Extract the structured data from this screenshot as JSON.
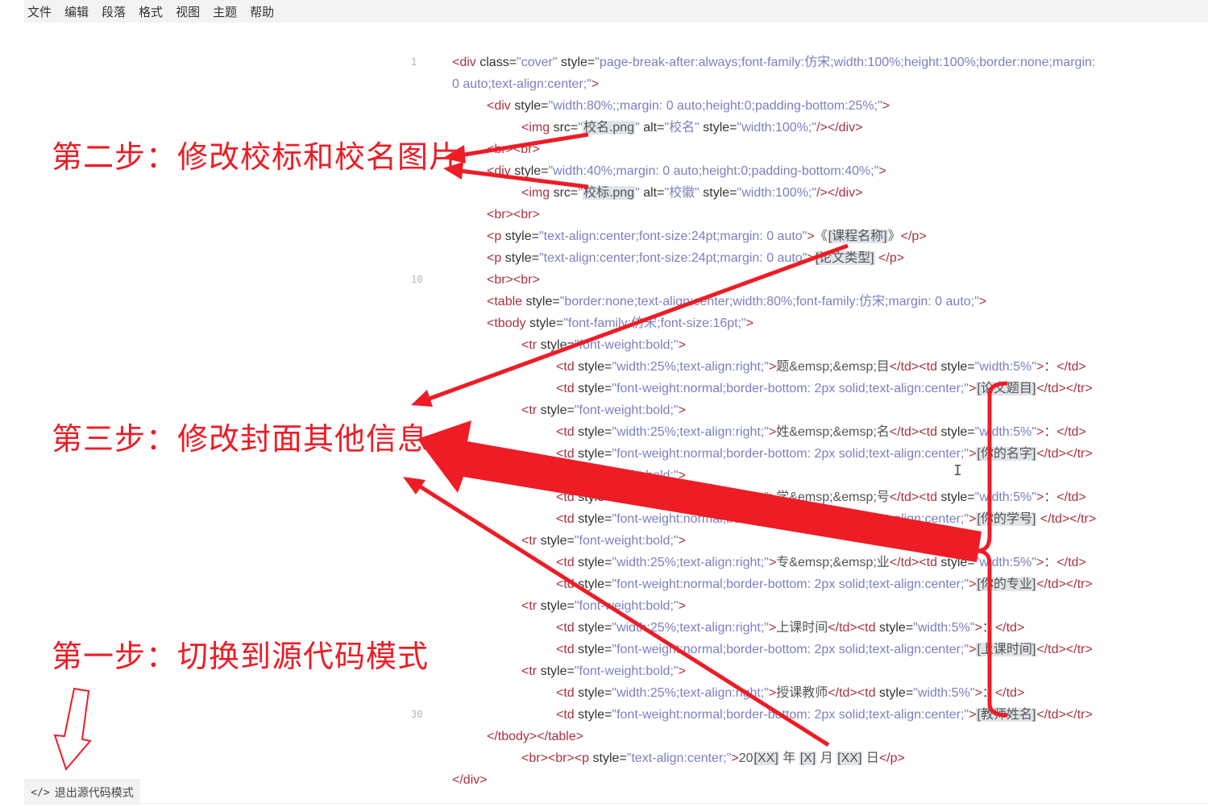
{
  "menubar": {
    "items": [
      "文件",
      "编辑",
      "段落",
      "格式",
      "视图",
      "主题",
      "帮助"
    ]
  },
  "annotations": {
    "step2": "第二步：修改校标和校名图片",
    "step3": "第三步：修改封面其他信息",
    "step1": "第一步：切换到源代码模式"
  },
  "statusbar": {
    "exit_icon": "</>",
    "exit_label": "退出源代码模式"
  },
  "code": {
    "line_numbers": [
      "1",
      "10",
      "30"
    ],
    "lines": [
      {
        "indent": 0,
        "ln": "1",
        "tokens": [
          [
            "tag",
            "<div "
          ],
          [
            "attr",
            "class="
          ],
          [
            "str",
            "\"cover\" "
          ],
          [
            "attr",
            "style="
          ],
          [
            "str",
            "\"page-break-after:always;font-family:仿宋;width:100%;height:100%;border:none;margin:"
          ]
        ]
      },
      {
        "indent": 0,
        "tokens": [
          [
            "str",
            "0 auto;text-align:center;\""
          ],
          [
            "tag",
            ">"
          ]
        ]
      },
      {
        "indent": 1,
        "tokens": [
          [
            "tag",
            "<div "
          ],
          [
            "attr",
            "style="
          ],
          [
            "str",
            "\"width:80%;;margin: 0 auto;height:0;padding-bottom:25%;\""
          ],
          [
            "tag",
            ">"
          ]
        ]
      },
      {
        "indent": 2,
        "tokens": [
          [
            "tag",
            "<img "
          ],
          [
            "attr",
            "src="
          ],
          [
            "str",
            "\""
          ],
          [
            "hl",
            "校名.png"
          ],
          [
            "str",
            "\" "
          ],
          [
            "attr",
            "alt="
          ],
          [
            "str",
            "\"校名\" "
          ],
          [
            "attr",
            "style="
          ],
          [
            "str",
            "\"width:100%;\""
          ],
          [
            "tag",
            "/></div>"
          ]
        ]
      },
      {
        "indent": 1,
        "tokens": [
          [
            "tag",
            "<br><br>"
          ]
        ]
      },
      {
        "indent": 1,
        "tokens": [
          [
            "tag",
            "<div "
          ],
          [
            "attr",
            "style="
          ],
          [
            "str",
            "\"width:40%;margin: 0 auto;height:0;padding-bottom:40%;\""
          ],
          [
            "tag",
            ">"
          ]
        ]
      },
      {
        "indent": 2,
        "tokens": [
          [
            "tag",
            "<img "
          ],
          [
            "attr",
            "src="
          ],
          [
            "str",
            "\""
          ],
          [
            "hl",
            "校标.png"
          ],
          [
            "str",
            "\" "
          ],
          [
            "attr",
            "alt="
          ],
          [
            "str",
            "\"校徽\" "
          ],
          [
            "attr",
            "style="
          ],
          [
            "str",
            "\"width:100%;\""
          ],
          [
            "tag",
            "/></div>"
          ]
        ]
      },
      {
        "indent": 1,
        "tokens": [
          [
            "tag",
            "<br><br>"
          ]
        ]
      },
      {
        "indent": 1,
        "tokens": [
          [
            "tag",
            "<p "
          ],
          [
            "attr",
            "style="
          ],
          [
            "str",
            "\"text-align:center;font-size:24pt;margin: 0 auto\""
          ],
          [
            "tag",
            ">"
          ],
          [
            "txt",
            "《"
          ],
          [
            "hl",
            "[课程名称]"
          ],
          [
            "txt",
            "》"
          ],
          [
            "tag",
            "</p>"
          ]
        ]
      },
      {
        "indent": 1,
        "tokens": [
          [
            "tag",
            "<p "
          ],
          [
            "attr",
            "style="
          ],
          [
            "str",
            "\"text-align:center;font-size:24pt;margin: 0 auto\""
          ],
          [
            "tag",
            ">"
          ],
          [
            "hl",
            "[论文类型]"
          ],
          [
            "tag",
            " </p>"
          ]
        ]
      },
      {
        "indent": 1,
        "ln": "10",
        "tokens": [
          [
            "tag",
            "<br><br>"
          ]
        ]
      },
      {
        "indent": 1,
        "tokens": [
          [
            "tag",
            "<table "
          ],
          [
            "attr",
            "style="
          ],
          [
            "str",
            "\"border:none;text-align:center;width:80%;font-family:仿宋;margin: 0 auto;\""
          ],
          [
            "tag",
            ">"
          ]
        ]
      },
      {
        "indent": 1,
        "tokens": [
          [
            "tag",
            "<tbody "
          ],
          [
            "attr",
            "style="
          ],
          [
            "str",
            "\"font-family:仿宋;font-size:16pt;\""
          ],
          [
            "tag",
            ">"
          ]
        ]
      },
      {
        "indent": 2,
        "tokens": [
          [
            "tag",
            "<tr "
          ],
          [
            "attr",
            "style="
          ],
          [
            "str",
            "\"font-weight:bold;\""
          ],
          [
            "tag",
            ">"
          ]
        ]
      },
      {
        "indent": 3,
        "tokens": [
          [
            "tag",
            "<td "
          ],
          [
            "attr",
            "style="
          ],
          [
            "str",
            "\"width:25%;text-align:right;\""
          ],
          [
            "tag",
            ">"
          ],
          [
            "txt",
            "题&emsp;&emsp;目"
          ],
          [
            "tag",
            "</td><td "
          ],
          [
            "attr",
            "style="
          ],
          [
            "str",
            "\"width:5%\""
          ],
          [
            "tag",
            ">"
          ],
          [
            "txt",
            "："
          ],
          [
            "tag",
            "</td>"
          ]
        ]
      },
      {
        "indent": 3,
        "tokens": [
          [
            "tag",
            "<td "
          ],
          [
            "attr",
            "style="
          ],
          [
            "str",
            "\"font-weight:normal;border-bottom: 2px solid;text-align:center;\""
          ],
          [
            "tag",
            ">"
          ],
          [
            "hl",
            "[论文题目]"
          ],
          [
            "tag",
            "</td></tr>"
          ]
        ]
      },
      {
        "indent": 2,
        "tokens": [
          [
            "tag",
            "<tr "
          ],
          [
            "attr",
            "style="
          ],
          [
            "str",
            "\"font-weight:bold;\""
          ],
          [
            "tag",
            ">"
          ]
        ]
      },
      {
        "indent": 3,
        "tokens": [
          [
            "tag",
            "<td "
          ],
          [
            "attr",
            "style="
          ],
          [
            "str",
            "\"width:25%;text-align:right;\""
          ],
          [
            "tag",
            ">"
          ],
          [
            "txt",
            "姓&emsp;&emsp;名"
          ],
          [
            "tag",
            "</td><td "
          ],
          [
            "attr",
            "style="
          ],
          [
            "str",
            "\"width:5%\""
          ],
          [
            "tag",
            ">"
          ],
          [
            "txt",
            "："
          ],
          [
            "tag",
            "</td>"
          ]
        ]
      },
      {
        "indent": 3,
        "tokens": [
          [
            "tag",
            "<td "
          ],
          [
            "attr",
            "style="
          ],
          [
            "str",
            "\"font-weight:normal;border-bottom: 2px solid;text-align:center;\""
          ],
          [
            "tag",
            ">"
          ],
          [
            "hl",
            "[你的名字]"
          ],
          [
            "tag",
            "</td></tr>"
          ]
        ]
      },
      {
        "indent": 2,
        "tokens": [
          [
            "tag",
            "<tr "
          ],
          [
            "attr",
            "style="
          ],
          [
            "str",
            "\"font-weight:bold;\""
          ],
          [
            "tag",
            ">"
          ]
        ]
      },
      {
        "indent": 3,
        "tokens": [
          [
            "tag",
            "<td "
          ],
          [
            "attr",
            "style="
          ],
          [
            "str",
            "\"width:25%;text-align:right;\""
          ],
          [
            "tag",
            ">"
          ],
          [
            "txt",
            "学&emsp;&emsp;号"
          ],
          [
            "tag",
            "</td><td "
          ],
          [
            "attr",
            "style="
          ],
          [
            "str",
            "\"width:5%\""
          ],
          [
            "tag",
            ">"
          ],
          [
            "txt",
            "："
          ],
          [
            "tag",
            "</td>"
          ]
        ]
      },
      {
        "indent": 3,
        "tokens": [
          [
            "tag",
            "<td "
          ],
          [
            "attr",
            "style="
          ],
          [
            "str",
            "\"font-weight:normal;border-bottom: 2px solid;text-align:center;\""
          ],
          [
            "tag",
            ">"
          ],
          [
            "hl",
            "[你的学号]"
          ],
          [
            "tag",
            " </td></tr>"
          ]
        ]
      },
      {
        "indent": 2,
        "tokens": [
          [
            "tag",
            "<tr "
          ],
          [
            "attr",
            "style="
          ],
          [
            "str",
            "\"font-weight:bold;\""
          ],
          [
            "tag",
            ">"
          ]
        ]
      },
      {
        "indent": 3,
        "tokens": [
          [
            "tag",
            "<td "
          ],
          [
            "attr",
            "style="
          ],
          [
            "str",
            "\"width:25%;text-align:right;\""
          ],
          [
            "tag",
            ">"
          ],
          [
            "txt",
            "专&emsp;&emsp;业"
          ],
          [
            "tag",
            "</td><td "
          ],
          [
            "attr",
            "style="
          ],
          [
            "str",
            "\"width:5%\""
          ],
          [
            "tag",
            ">"
          ],
          [
            "txt",
            "："
          ],
          [
            "tag",
            "</td>"
          ]
        ]
      },
      {
        "indent": 3,
        "tokens": [
          [
            "tag",
            "<td "
          ],
          [
            "attr",
            "style="
          ],
          [
            "str",
            "\"font-weight:normal;border-bottom: 2px solid;text-align:center;\""
          ],
          [
            "tag",
            ">"
          ],
          [
            "hl",
            "[你的专业]"
          ],
          [
            "tag",
            "</td></tr>"
          ]
        ]
      },
      {
        "indent": 2,
        "tokens": [
          [
            "tag",
            "<tr "
          ],
          [
            "attr",
            "style="
          ],
          [
            "str",
            "\"font-weight:bold;\""
          ],
          [
            "tag",
            ">"
          ]
        ]
      },
      {
        "indent": 3,
        "tokens": [
          [
            "tag",
            "<td "
          ],
          [
            "attr",
            "style="
          ],
          [
            "str",
            "\"width:25%;text-align:right;\""
          ],
          [
            "tag",
            ">"
          ],
          [
            "txt",
            "上课时间"
          ],
          [
            "tag",
            "</td><td "
          ],
          [
            "attr",
            "style="
          ],
          [
            "str",
            "\"width:5%\""
          ],
          [
            "tag",
            ">"
          ],
          [
            "txt",
            "："
          ],
          [
            "tag",
            "</td>"
          ]
        ]
      },
      {
        "indent": 3,
        "tokens": [
          [
            "tag",
            "<td "
          ],
          [
            "attr",
            "style="
          ],
          [
            "str",
            "\"font-weight:normal;border-bottom: 2px solid;text-align:center;\""
          ],
          [
            "tag",
            ">"
          ],
          [
            "hl",
            "[上课时间]"
          ],
          [
            "tag",
            "</td></tr>"
          ]
        ]
      },
      {
        "indent": 2,
        "tokens": [
          [
            "tag",
            "<tr "
          ],
          [
            "attr",
            "style="
          ],
          [
            "str",
            "\"font-weight:bold;\""
          ],
          [
            "tag",
            ">"
          ]
        ]
      },
      {
        "indent": 3,
        "tokens": [
          [
            "tag",
            "<td "
          ],
          [
            "attr",
            "style="
          ],
          [
            "str",
            "\"width:25%;text-align:right;\""
          ],
          [
            "tag",
            ">"
          ],
          [
            "txt",
            "授课教师"
          ],
          [
            "tag",
            "</td><td "
          ],
          [
            "attr",
            "style="
          ],
          [
            "str",
            "\"width:5%\""
          ],
          [
            "tag",
            ">"
          ],
          [
            "txt",
            "："
          ],
          [
            "tag",
            "</td>"
          ]
        ]
      },
      {
        "indent": 3,
        "ln": "30",
        "tokens": [
          [
            "tag",
            "<td "
          ],
          [
            "attr",
            "style="
          ],
          [
            "str",
            "\"font-weight:normal;border-bottom: 2px solid;text-align:center;\""
          ],
          [
            "tag",
            ">"
          ],
          [
            "hl",
            "[教师姓名]"
          ],
          [
            "tag",
            "</td></tr>"
          ]
        ]
      },
      {
        "indent": 1,
        "tokens": [
          [
            "tag",
            "</tbody></table>"
          ]
        ]
      },
      {
        "indent": 2,
        "tokens": [
          [
            "tag",
            "<br><br><p "
          ],
          [
            "attr",
            "style="
          ],
          [
            "str",
            "\"text-align:center;\""
          ],
          [
            "tag",
            ">"
          ],
          [
            "txt",
            "20"
          ],
          [
            "hl",
            "[XX]"
          ],
          [
            "txt",
            " 年 "
          ],
          [
            "hl",
            "[X]"
          ],
          [
            "txt",
            " 月 "
          ],
          [
            "hl",
            "[XX]"
          ],
          [
            "txt",
            " 日"
          ],
          [
            "tag",
            "</p>"
          ]
        ]
      },
      {
        "indent": 0,
        "tokens": [
          [
            "tag",
            "</div>"
          ]
        ]
      }
    ]
  },
  "colors": {
    "annotation_red": "#ee1c25",
    "tag": "#a8323e",
    "string": "#7a7fc0",
    "highlight_bg": "#dfe4ea"
  }
}
